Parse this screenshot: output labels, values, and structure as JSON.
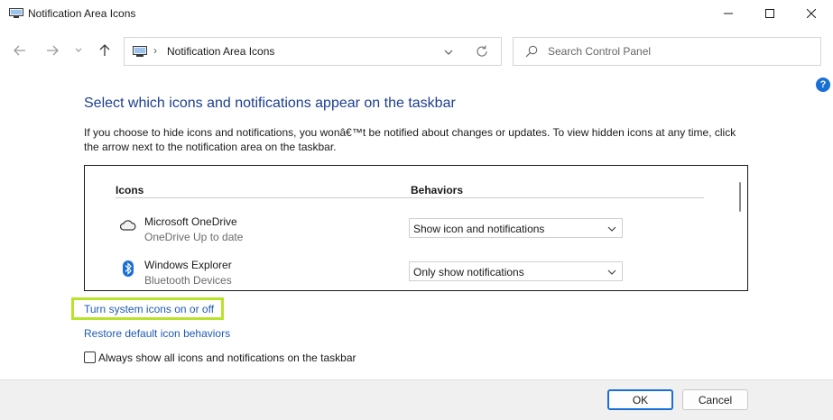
{
  "window": {
    "title": "Notification Area Icons",
    "icon": "control-panel-icon"
  },
  "nav": {
    "back_icon": "arrow-left-icon",
    "forward_icon": "arrow-right-icon",
    "recent_icon": "chevron-down-icon",
    "up_icon": "arrow-up-icon"
  },
  "address": {
    "separator": "›",
    "location": "Notification Area Icons"
  },
  "search": {
    "placeholder": "Search Control Panel"
  },
  "help": {
    "label": "?"
  },
  "content": {
    "title": "Select which icons and notifications appear on the taskbar",
    "description": "If you choose to hide icons and notifications, you wonâ€™t be notified about changes or updates. To view hidden icons at any time, click the arrow next to the notification area on the taskbar."
  },
  "table": {
    "headers": {
      "icons": "Icons",
      "behaviors": "Behaviors"
    },
    "rows": [
      {
        "name": "Microsoft OneDrive",
        "status": "OneDrive Up to date",
        "behavior": "Show icon and notifications",
        "icon": "cloud-icon"
      },
      {
        "name": "Windows Explorer",
        "status": "Bluetooth Devices",
        "behavior": "Only show notifications",
        "icon": "bluetooth-icon"
      }
    ]
  },
  "links": {
    "system_icons": "Turn system icons on or off",
    "restore_defaults": "Restore default icon behaviors"
  },
  "checkbox": {
    "label": "Always show all icons and notifications on the taskbar",
    "checked": false
  },
  "footer": {
    "ok": "OK",
    "cancel": "Cancel"
  },
  "colors": {
    "title_blue": "#1e3f8f",
    "link_blue": "#1f5bb5",
    "highlight": "#b9e32a",
    "accent": "#1a6fd6"
  }
}
